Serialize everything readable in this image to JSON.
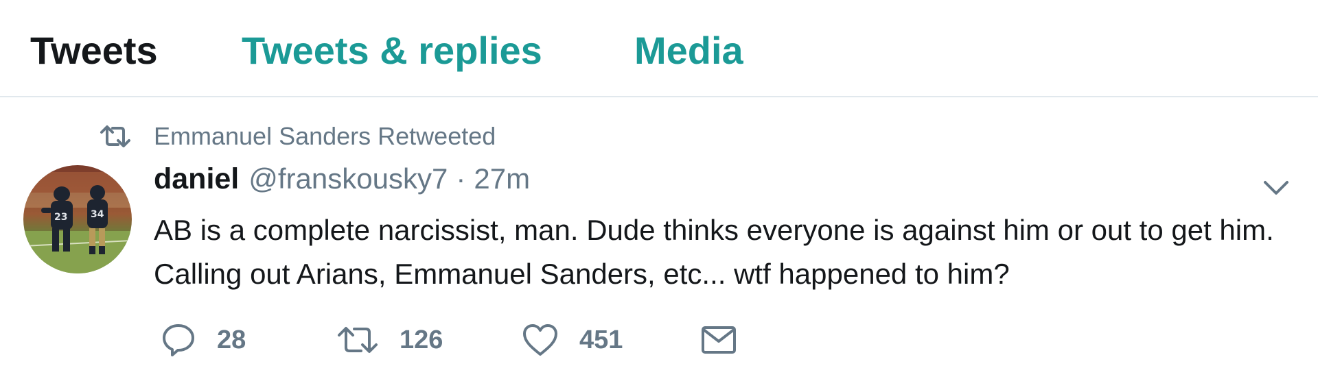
{
  "tabs": [
    {
      "label": "Tweets",
      "active": true
    },
    {
      "label": "Tweets & replies",
      "active": false
    },
    {
      "label": "Media",
      "active": false
    }
  ],
  "colors": {
    "accent": "#1b9a96",
    "text": "#14171a",
    "muted": "#657786",
    "divider": "#e1e8ed"
  },
  "tweet": {
    "retweet_context": "Emmanuel Sanders Retweeted",
    "author": {
      "name": "daniel",
      "handle": "@franskousky7"
    },
    "separator": "·",
    "time": "27m",
    "text": "AB is a complete narcissist, man. Dude thinks everyone is against him or out to get him. Calling out Arians, Emmanuel Sanders, etc... wtf happened to him?",
    "actions": {
      "reply_count": "28",
      "retweet_count": "126",
      "like_count": "451"
    },
    "icons": [
      "retweet-icon",
      "chevron-down-icon",
      "reply-icon",
      "heart-icon",
      "envelope-icon"
    ]
  }
}
